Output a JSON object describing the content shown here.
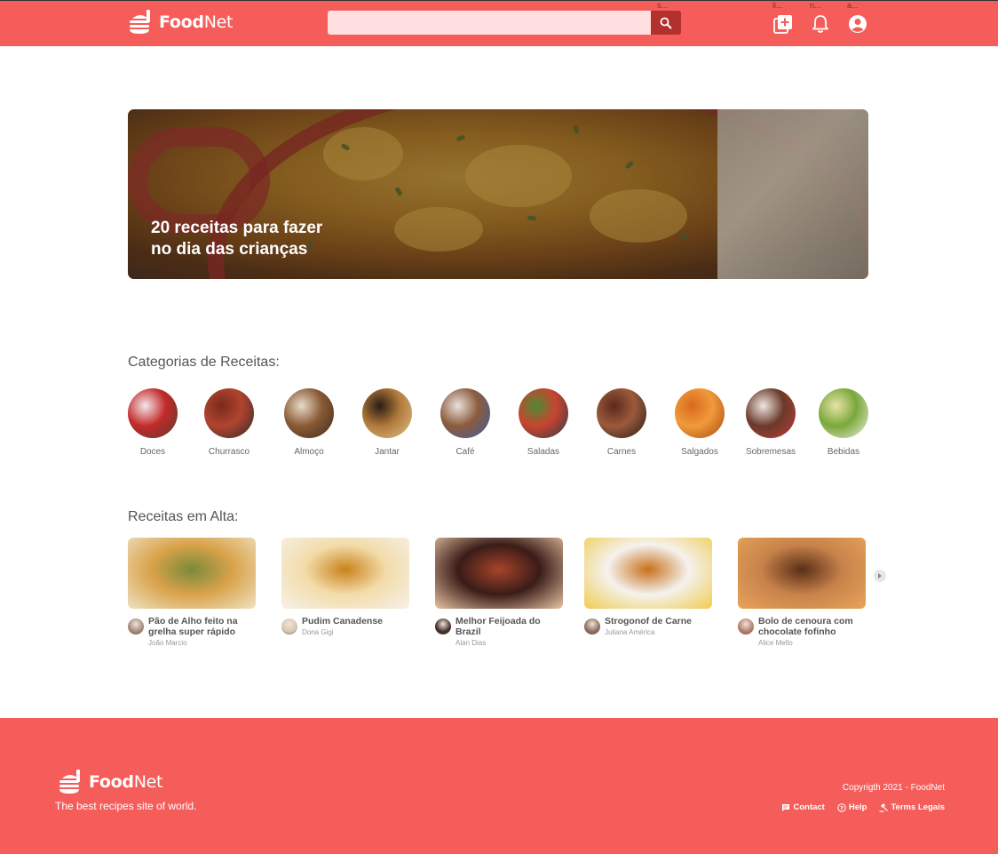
{
  "header": {
    "brand_bold": "Food",
    "brand_light": "Net",
    "search_placeholder": "",
    "search_tooltip": "s...",
    "icons": [
      {
        "name": "add-recipe-icon",
        "tooltip": "li..."
      },
      {
        "name": "notification-bell-icon",
        "tooltip": "n..."
      },
      {
        "name": "account-icon",
        "tooltip": "a..."
      }
    ]
  },
  "hero": {
    "title_line1": "20 receitas para fazer",
    "title_line2": "no dia das crianças"
  },
  "categories": {
    "title": "Categorias de Receitas:",
    "items": [
      {
        "label": "Doces",
        "colors": [
          "#f3e7e9",
          "#c22a2a",
          "#5a3b2d"
        ]
      },
      {
        "label": "Churrasco",
        "colors": [
          "#7a2a1c",
          "#b0442f",
          "#2d2a28"
        ]
      },
      {
        "label": "Almoço",
        "colors": [
          "#e6dbc9",
          "#8a5a34",
          "#3b2b22"
        ]
      },
      {
        "label": "Jantar",
        "colors": [
          "#2a1c15",
          "#b07a3a",
          "#e2c28a"
        ]
      },
      {
        "label": "Café",
        "colors": [
          "#e9e2dc",
          "#8c5b3d",
          "#3a5fa8"
        ]
      },
      {
        "label": "Saladas",
        "colors": [
          "#4e8a34",
          "#c8442f",
          "#2b3a4a"
        ]
      },
      {
        "label": "Carnes",
        "colors": [
          "#5a2a1c",
          "#9c5a3c",
          "#221a16"
        ]
      },
      {
        "label": "Salgados",
        "colors": [
          "#d86a1c",
          "#f09a3a",
          "#a84812"
        ]
      },
      {
        "label": "Sobremesas",
        "colors": [
          "#efe6e2",
          "#6a3a2a",
          "#c23a3a"
        ]
      },
      {
        "label": "Bebidas",
        "colors": [
          "#e8e2a8",
          "#7aa83a",
          "#f0efe6"
        ]
      }
    ]
  },
  "trending": {
    "title": "Receitas em Alta:",
    "items": [
      {
        "title": "Pão de Alho feito na grelha super rápido",
        "author": "João Marcio",
        "colors": [
          "#d9a24a",
          "#7a8a3a",
          "#efe2c2"
        ],
        "avatar": "#a0887a"
      },
      {
        "title": "Pudim Canadense",
        "author": "Dona Gigi",
        "colors": [
          "#f3dcaa",
          "#c9821a",
          "#f6f1ea"
        ],
        "avatar": "#d8c6b4"
      },
      {
        "title": "Melhor Feijoada do Brazil",
        "author": "Alan Dias",
        "colors": [
          "#3a1c18",
          "#a8442a",
          "#e8c4a4"
        ],
        "avatar": "#3a2a24"
      },
      {
        "title": "Strogonof de Carne",
        "author": "Juliana América",
        "colors": [
          "#f4f2ee",
          "#c8701a",
          "#f0cc50"
        ],
        "avatar": "#8a6a5a"
      },
      {
        "title": "Bolo de cenoura com chocolate fofinho",
        "author": "Alice Mello",
        "colors": [
          "#c7824a",
          "#5a2e18",
          "#e9a45a"
        ],
        "avatar": "#b07a6a"
      }
    ]
  },
  "footer": {
    "brand_bold": "Food",
    "brand_light": "Net",
    "tagline": "The best recipes site of world.",
    "copyright": "Copyrigth 2021 - FoodNet",
    "links": {
      "contact": "Contact",
      "help": "Help",
      "terms": "Terms Legais"
    }
  },
  "colors": {
    "brand": "#f55d5a",
    "search_bg": "#ffdfe0",
    "search_btn": "#b3302f"
  }
}
